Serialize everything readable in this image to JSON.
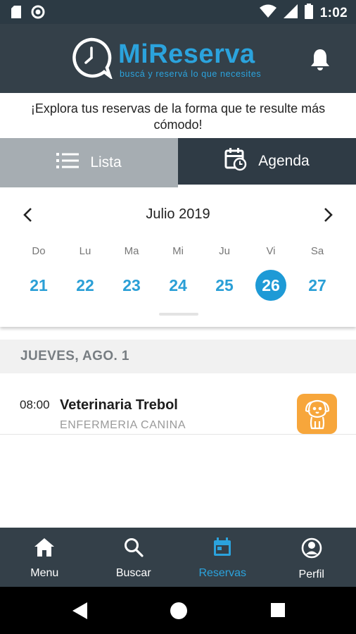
{
  "status_bar": {
    "time": "1:02",
    "left_icons": [
      "sd-card-icon",
      "circle-notification-icon"
    ],
    "right_icons": [
      "wifi-icon",
      "signal-icon",
      "battery-icon"
    ]
  },
  "header": {
    "brand_mi": "Mi",
    "brand_reserva": "Reserva",
    "tagline": "buscá y reservá lo que necesites",
    "logo_icon": "clock-bubble-icon",
    "notifications_icon": "bell-icon",
    "colors": {
      "background": "#344049",
      "accent": "#2ba3dd"
    }
  },
  "intro": {
    "text": "¡Explora tus reservas de la forma que te resulte más cómodo!"
  },
  "view_tabs": [
    {
      "label": "Lista",
      "icon": "list-icon",
      "active": false
    },
    {
      "label": "Agenda",
      "icon": "calendar-clock-icon",
      "active": true
    }
  ],
  "calendar": {
    "month_label": "Julio 2019",
    "prev_icon": "chevron-left-icon",
    "next_icon": "chevron-right-icon",
    "weekdays": [
      "Do",
      "Lu",
      "Ma",
      "Mi",
      "Ju",
      "Vi",
      "Sa"
    ],
    "days": [
      "21",
      "22",
      "23",
      "24",
      "25",
      "26",
      "27"
    ],
    "selected_day": "26"
  },
  "section": {
    "date_header": "JUEVES, AGO. 1"
  },
  "bookings": [
    {
      "time": "08:00",
      "name": "Veterinaria Trebol",
      "category": "ENFERMERIA CANINA",
      "icon": "dog-icon",
      "icon_color": "#f7a63b"
    }
  ],
  "bottom_nav": [
    {
      "label": "Menu",
      "icon": "home-icon",
      "active": false
    },
    {
      "label": "Buscar",
      "icon": "search-icon",
      "active": false
    },
    {
      "label": "Reservas",
      "icon": "calendar-icon",
      "active": true
    },
    {
      "label": "Perfil",
      "icon": "profile-icon",
      "active": false
    }
  ],
  "system_nav": [
    "back-icon",
    "home-circle-icon",
    "recents-icon"
  ]
}
